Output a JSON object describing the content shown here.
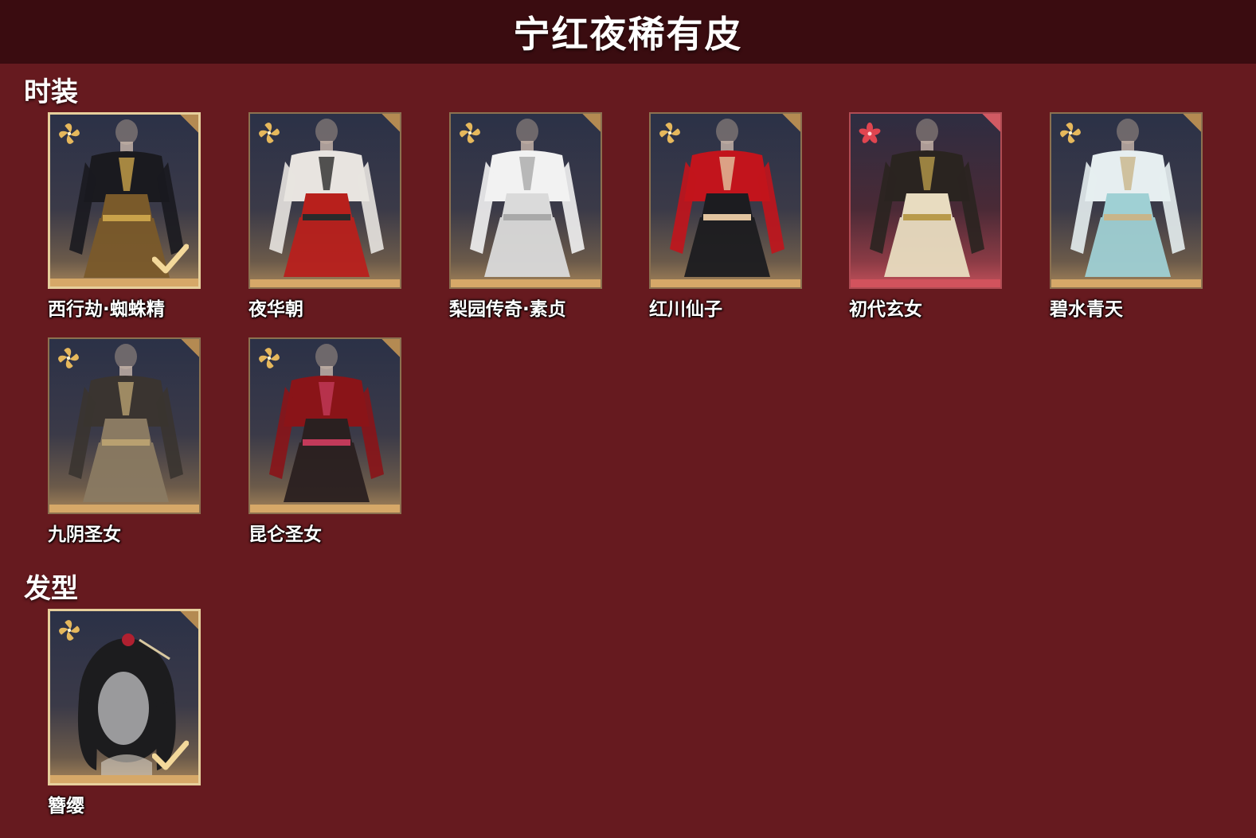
{
  "title": "宁红夜稀有皮",
  "sections": {
    "fashion": {
      "label": "时装",
      "items": [
        {
          "name": "西行劫·蜘蛛精",
          "rarity": "gold",
          "selected": true,
          "palette": [
            "#1a1a1f",
            "#7a5a2a",
            "#c9a24a"
          ]
        },
        {
          "name": "夜华朝",
          "rarity": "gold",
          "selected": false,
          "palette": [
            "#e8e4e0",
            "#b8201c",
            "#2a2a2a"
          ]
        },
        {
          "name": "梨园传奇·素贞",
          "rarity": "gold",
          "selected": false,
          "palette": [
            "#f2f2f2",
            "#dadada",
            "#a9a9a9"
          ]
        },
        {
          "name": "红川仙子",
          "rarity": "gold",
          "selected": false,
          "palette": [
            "#c2141c",
            "#1c1c20",
            "#e2c4a0"
          ]
        },
        {
          "name": "初代玄女",
          "rarity": "red",
          "selected": false,
          "palette": [
            "#2a2420",
            "#e8dcc0",
            "#b89a4a"
          ]
        },
        {
          "name": "碧水青天",
          "rarity": "gold",
          "selected": false,
          "palette": [
            "#e6eef0",
            "#9fd0d4",
            "#c9b58a"
          ]
        },
        {
          "name": "九阴圣女",
          "rarity": "gold",
          "selected": false,
          "palette": [
            "#3a3430",
            "#8a7a62",
            "#b8a070"
          ]
        },
        {
          "name": "昆仑圣女",
          "rarity": "gold",
          "selected": false,
          "palette": [
            "#8a1418",
            "#2a2020",
            "#c23a5a"
          ]
        }
      ]
    },
    "hairstyle": {
      "label": "发型",
      "items": [
        {
          "name": "簪缨",
          "rarity": "gold",
          "selected": true,
          "palette": [
            "#1c1c1e",
            "#9a9a9c",
            "#d8d2c8"
          ]
        }
      ]
    }
  },
  "colors": {
    "background": "#661a1f",
    "titlebar": "#3a0c10",
    "gold_accent": "#d6a868",
    "red_accent": "#d2535d",
    "check": "#f3d89a"
  },
  "icons": {
    "gold_rarity": "gold-four-petal-flower-icon",
    "red_rarity": "red-five-petal-flower-icon",
    "owned": "checkmark-icon"
  }
}
